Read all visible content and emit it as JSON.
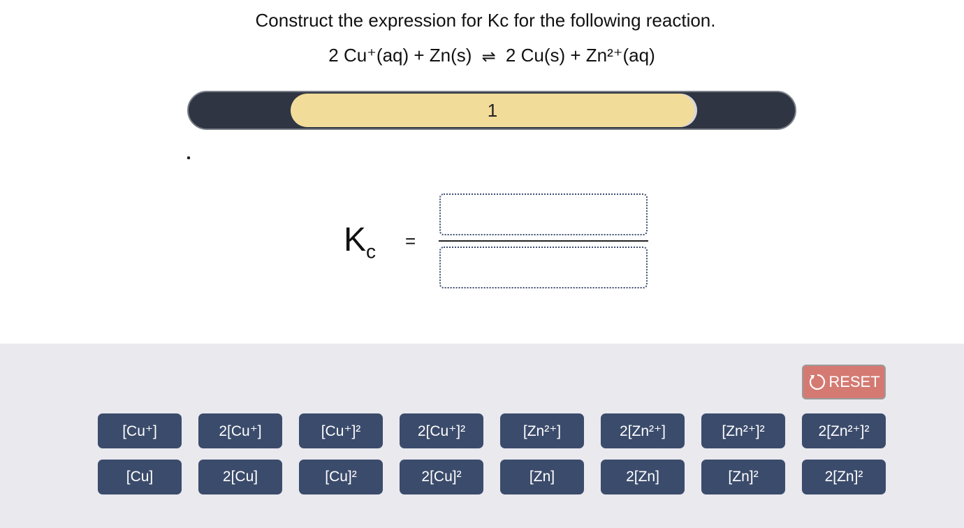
{
  "question": {
    "title": "Construct the expression for Kc for the following reaction.",
    "reaction_left": "2 Cu⁺(aq) + Zn(s)",
    "reaction_arrow": "⇌",
    "reaction_right": "2 Cu(s) + Zn²⁺(aq)"
  },
  "slider": {
    "value_label": "1"
  },
  "expression": {
    "kc_symbol": "K",
    "kc_subscript": "c",
    "equals": "="
  },
  "controls": {
    "reset_label": "RESET"
  },
  "tiles_row1": [
    "[Cu⁺]",
    "2[Cu⁺]",
    "[Cu⁺]²",
    "2[Cu⁺]²",
    "[Zn²⁺]",
    "2[Zn²⁺]",
    "[Zn²⁺]²",
    "2[Zn²⁺]²"
  ],
  "tiles_row2": [
    "[Cu]",
    "2[Cu]",
    "[Cu]²",
    "2[Cu]²",
    "[Zn]",
    "2[Zn]",
    "[Zn]²",
    "2[Zn]²"
  ],
  "colors": {
    "tile_bg": "#3b4b6b",
    "reset_bg": "#d47a72",
    "slider_track": "#2f3542",
    "slider_pill": "#f2dc9a",
    "tray_bg": "#e9e9ee"
  }
}
